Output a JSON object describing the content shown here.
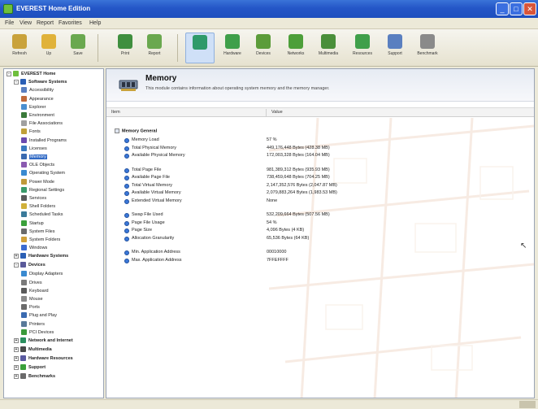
{
  "window": {
    "title": "EVEREST Home Edition"
  },
  "menu": [
    "File",
    "View",
    "Report",
    "Favorites",
    "Help"
  ],
  "toolbar": [
    {
      "label": "Refresh",
      "color": "#c9a23b"
    },
    {
      "label": "Up",
      "color": "#e0b23a"
    },
    {
      "label": "Save",
      "color": "#6aa84f"
    },
    {
      "label": "Print",
      "color": "#3f8f3f"
    },
    {
      "label": "Report",
      "color": "#6aa84f"
    },
    {
      "label": "",
      "color": "#2e9a6a",
      "active": true
    },
    {
      "label": "Hardware",
      "color": "#3f9f4a"
    },
    {
      "label": "Devices",
      "color": "#5c9c3a"
    },
    {
      "label": "Networks",
      "color": "#4d9f3a"
    },
    {
      "label": "Multimedia",
      "color": "#4a8f3a"
    },
    {
      "label": "Resources",
      "color": "#3f9f4a"
    },
    {
      "label": "Support",
      "color": "#5a7fc0"
    },
    {
      "label": "Benchmark",
      "color": "#8a8a8a"
    }
  ],
  "tree": [
    {
      "label": "EVEREST Home",
      "level": 0,
      "bold": true,
      "expander": "-",
      "color": "#6fbf3d"
    },
    {
      "label": "Software Systems",
      "level": 1,
      "bold": true,
      "expander": "-",
      "color": "#2b5fb5"
    },
    {
      "label": "Accessibility",
      "level": 2,
      "color": "#5a7fc0"
    },
    {
      "label": "Appearance",
      "level": 2,
      "color": "#c06a3a"
    },
    {
      "label": "Explorer",
      "level": 2,
      "color": "#4a8fd0"
    },
    {
      "label": "Environment",
      "level": 2,
      "color": "#3a7a3a"
    },
    {
      "label": "File Associations",
      "level": 2,
      "color": "#a0a0a0"
    },
    {
      "label": "Fonts",
      "level": 2,
      "color": "#c0a03a"
    },
    {
      "label": "Installed Programs",
      "level": 2,
      "color": "#6a4ab0"
    },
    {
      "label": "Licenses",
      "level": 2,
      "color": "#3a7ac0"
    },
    {
      "label": "Memory",
      "level": 2,
      "color": "#3a6ab0",
      "selected": true
    },
    {
      "label": "OLE Objects",
      "level": 2,
      "color": "#8a5ab0"
    },
    {
      "label": "Operating System",
      "level": 2,
      "color": "#3a8ad0"
    },
    {
      "label": "Power Mode",
      "level": 2,
      "color": "#c09a3a"
    },
    {
      "label": "Regional Settings",
      "level": 2,
      "color": "#3a9a6a"
    },
    {
      "label": "Services",
      "level": 2,
      "color": "#5a5a5a"
    },
    {
      "label": "Shell Folders",
      "level": 2,
      "color": "#d0b03a"
    },
    {
      "label": "Scheduled Tasks",
      "level": 2,
      "color": "#3a7a9a"
    },
    {
      "label": "Startup",
      "level": 2,
      "color": "#3aa03a"
    },
    {
      "label": "System Files",
      "level": 2,
      "color": "#6a6a6a"
    },
    {
      "label": "System Folders",
      "level": 2,
      "color": "#d0a03a"
    },
    {
      "label": "Windows",
      "level": 2,
      "color": "#3a6ad0"
    },
    {
      "label": "Hardware Systems",
      "level": 1,
      "bold": true,
      "expander": "+",
      "color": "#2b5fb5"
    },
    {
      "label": "Devices",
      "level": 1,
      "bold": true,
      "expander": "-",
      "color": "#5a5a9a"
    },
    {
      "label": "Display Adapters",
      "level": 2,
      "color": "#3a8ad0"
    },
    {
      "label": "Drives",
      "level": 2,
      "color": "#7a7a7a"
    },
    {
      "label": "Keyboard",
      "level": 2,
      "color": "#5a5a5a"
    },
    {
      "label": "Mouse",
      "level": 2,
      "color": "#8a8a8a"
    },
    {
      "label": "Ports",
      "level": 2,
      "color": "#6a6a6a"
    },
    {
      "label": "Plug and Play",
      "level": 2,
      "color": "#3a6ab0"
    },
    {
      "label": "Printers",
      "level": 2,
      "color": "#5a7a9a"
    },
    {
      "label": "PCI Devices",
      "level": 2,
      "color": "#3a9a3a"
    },
    {
      "label": "Network and Internet",
      "level": 1,
      "bold": true,
      "expander": "+",
      "color": "#2b8f5f"
    },
    {
      "label": "Multimedia",
      "level": 1,
      "bold": true,
      "expander": "+",
      "color": "#4a4a4a"
    },
    {
      "label": "Hardware Resources",
      "level": 1,
      "bold": true,
      "expander": "+",
      "color": "#5a5aa0"
    },
    {
      "label": "Support",
      "level": 1,
      "bold": true,
      "expander": "+",
      "color": "#3aa03a"
    },
    {
      "label": "Benchmarks",
      "level": 1,
      "bold": true,
      "expander": "+",
      "color": "#6a6a6a"
    }
  ],
  "main": {
    "title": "Memory",
    "description": "This module contains information about operating system memory and the memory manager.",
    "col_item": "Item",
    "col_value": "Value",
    "group_title": "Memory General",
    "rows": [
      {
        "label": "Memory Load",
        "value": "57 %"
      },
      {
        "label": "Total Physical Memory",
        "value": "449,176,448 Bytes (428.38 MB)"
      },
      {
        "label": "Available Physical Memory",
        "value": "172,003,328 Bytes (164.04 MB)"
      },
      {
        "gap": true
      },
      {
        "label": "Total Page File",
        "value": "981,389,312 Bytes (935.93 MB)"
      },
      {
        "label": "Available Page File",
        "value": "738,459,648 Bytes (704.25 MB)"
      },
      {
        "label": "Total Virtual Memory",
        "value": "2,147,352,576 Bytes (2,047.87 MB)"
      },
      {
        "label": "Available Virtual Memory",
        "value": "2,079,883,264 Bytes (1,983.53 MB)"
      },
      {
        "label": "Extended Virtual Memory",
        "value": "None"
      },
      {
        "gap": true
      },
      {
        "label": "Swap File Used",
        "value": "532,209,664 Bytes (507.56 MB)"
      },
      {
        "label": "Page File Usage",
        "value": "54 %"
      },
      {
        "label": "Page Size",
        "value": "4,096 Bytes (4 KB)"
      },
      {
        "label": "Allocation Granularity",
        "value": "65,536 Bytes (64 KB)"
      },
      {
        "gap": true
      },
      {
        "label": "Min. Application Address",
        "value": "00010000"
      },
      {
        "label": "Max. Application Address",
        "value": "7FFEFFFF"
      }
    ]
  }
}
